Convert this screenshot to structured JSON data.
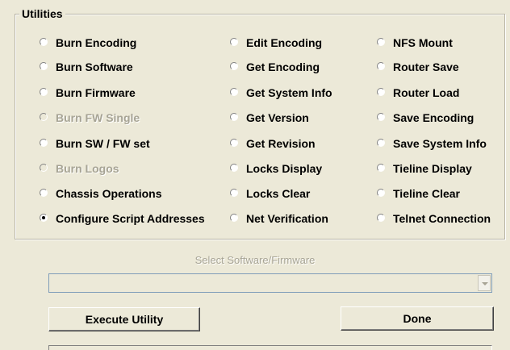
{
  "utilities": {
    "legend": "Utilities",
    "columns": [
      [
        {
          "label": "Burn Encoding",
          "selected": false,
          "enabled": true
        },
        {
          "label": "Burn Software",
          "selected": false,
          "enabled": true
        },
        {
          "label": "Burn Firmware",
          "selected": false,
          "enabled": true
        },
        {
          "label": "Burn FW Single",
          "selected": false,
          "enabled": false
        },
        {
          "label": "Burn SW / FW set",
          "selected": false,
          "enabled": true
        },
        {
          "label": "Burn Logos",
          "selected": false,
          "enabled": false
        },
        {
          "label": "Chassis Operations",
          "selected": false,
          "enabled": true
        },
        {
          "label": "Configure Script Addresses",
          "selected": true,
          "enabled": true
        }
      ],
      [
        {
          "label": "Edit Encoding",
          "selected": false,
          "enabled": true
        },
        {
          "label": "Get Encoding",
          "selected": false,
          "enabled": true
        },
        {
          "label": "Get System Info",
          "selected": false,
          "enabled": true
        },
        {
          "label": "Get Version",
          "selected": false,
          "enabled": true
        },
        {
          "label": "Get Revision",
          "selected": false,
          "enabled": true
        },
        {
          "label": "Locks Display",
          "selected": false,
          "enabled": true
        },
        {
          "label": "Locks Clear",
          "selected": false,
          "enabled": true
        },
        {
          "label": "Net Verification",
          "selected": false,
          "enabled": true
        }
      ],
      [
        {
          "label": "NFS Mount",
          "selected": false,
          "enabled": true
        },
        {
          "label": "Router Save",
          "selected": false,
          "enabled": true
        },
        {
          "label": "Router Load",
          "selected": false,
          "enabled": true
        },
        {
          "label": "Save Encoding",
          "selected": false,
          "enabled": true
        },
        {
          "label": "Save System Info",
          "selected": false,
          "enabled": true
        },
        {
          "label": "Tieline Display",
          "selected": false,
          "enabled": true
        },
        {
          "label": "Tieline Clear",
          "selected": false,
          "enabled": true
        },
        {
          "label": "Telnet Connection",
          "selected": false,
          "enabled": true
        }
      ]
    ]
  },
  "select": {
    "label": "Select Software/Firmware",
    "value": ""
  },
  "buttons": {
    "execute": "Execute Utility",
    "done": "Done"
  }
}
